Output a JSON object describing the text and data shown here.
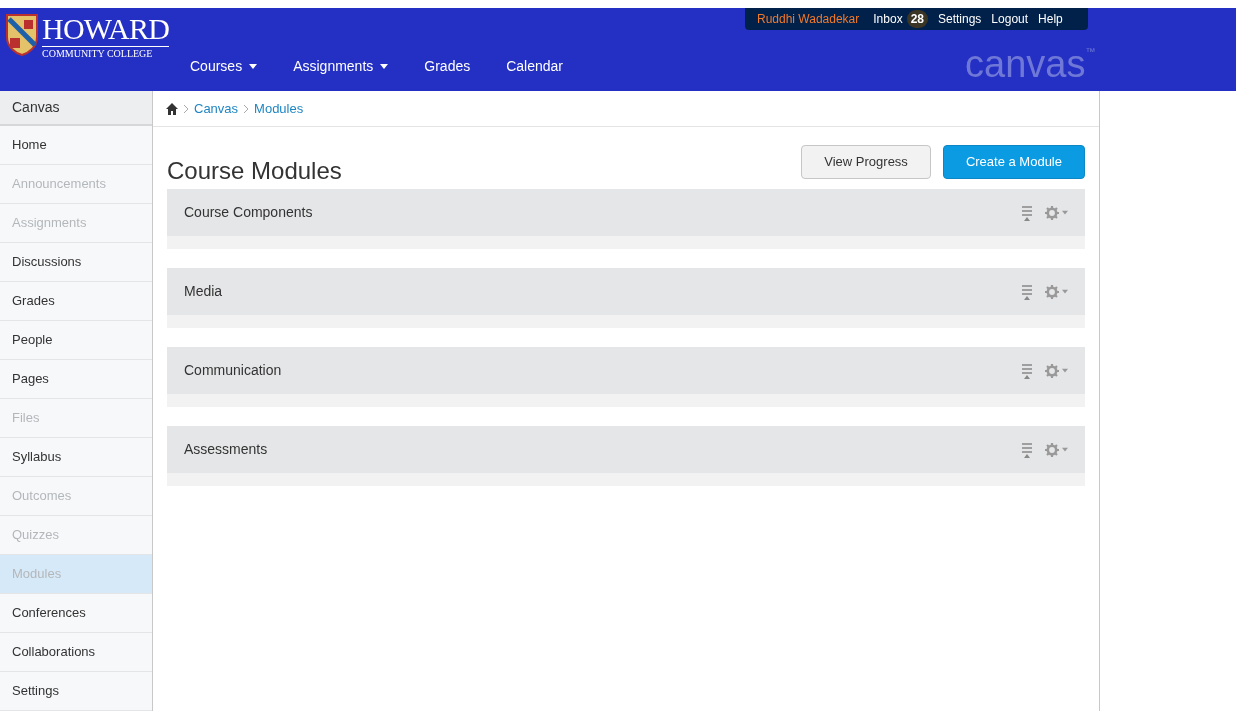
{
  "logo": {
    "name": "HOWARD",
    "subtitle": "COMMUNITY COLLEGE"
  },
  "nav": [
    {
      "label": "Courses",
      "dropdown": true
    },
    {
      "label": "Assignments",
      "dropdown": true
    },
    {
      "label": "Grades",
      "dropdown": false
    },
    {
      "label": "Calendar",
      "dropdown": false
    }
  ],
  "user_menu": {
    "user": "Ruddhi Wadadekar",
    "inbox": "Inbox",
    "inbox_count": "28",
    "links": [
      "Settings",
      "Logout",
      "Help"
    ]
  },
  "brand": {
    "name": "canvas",
    "mark": "™"
  },
  "sidebar": {
    "title": "Canvas",
    "items": [
      {
        "label": "Home",
        "disabled": false,
        "selected": false
      },
      {
        "label": "Announcements",
        "disabled": true,
        "selected": false
      },
      {
        "label": "Assignments",
        "disabled": true,
        "selected": false
      },
      {
        "label": "Discussions",
        "disabled": false,
        "selected": false
      },
      {
        "label": "Grades",
        "disabled": false,
        "selected": false
      },
      {
        "label": "People",
        "disabled": false,
        "selected": false
      },
      {
        "label": "Pages",
        "disabled": false,
        "selected": false
      },
      {
        "label": "Files",
        "disabled": true,
        "selected": false
      },
      {
        "label": "Syllabus",
        "disabled": false,
        "selected": false
      },
      {
        "label": "Outcomes",
        "disabled": true,
        "selected": false
      },
      {
        "label": "Quizzes",
        "disabled": true,
        "selected": false
      },
      {
        "label": "Modules",
        "disabled": true,
        "selected": true
      },
      {
        "label": "Conferences",
        "disabled": false,
        "selected": false
      },
      {
        "label": "Collaborations",
        "disabled": false,
        "selected": false
      },
      {
        "label": "Settings",
        "disabled": false,
        "selected": false
      }
    ]
  },
  "breadcrumb": [
    "Canvas",
    "Modules"
  ],
  "page_title": "Course Modules",
  "buttons": [
    {
      "label": "View Progress",
      "kind": "secondary"
    },
    {
      "label": "Create a Module",
      "kind": "primary"
    }
  ],
  "modules": [
    {
      "title": "Course Components"
    },
    {
      "title": "Media"
    },
    {
      "title": "Communication"
    },
    {
      "title": "Assessments"
    }
  ]
}
